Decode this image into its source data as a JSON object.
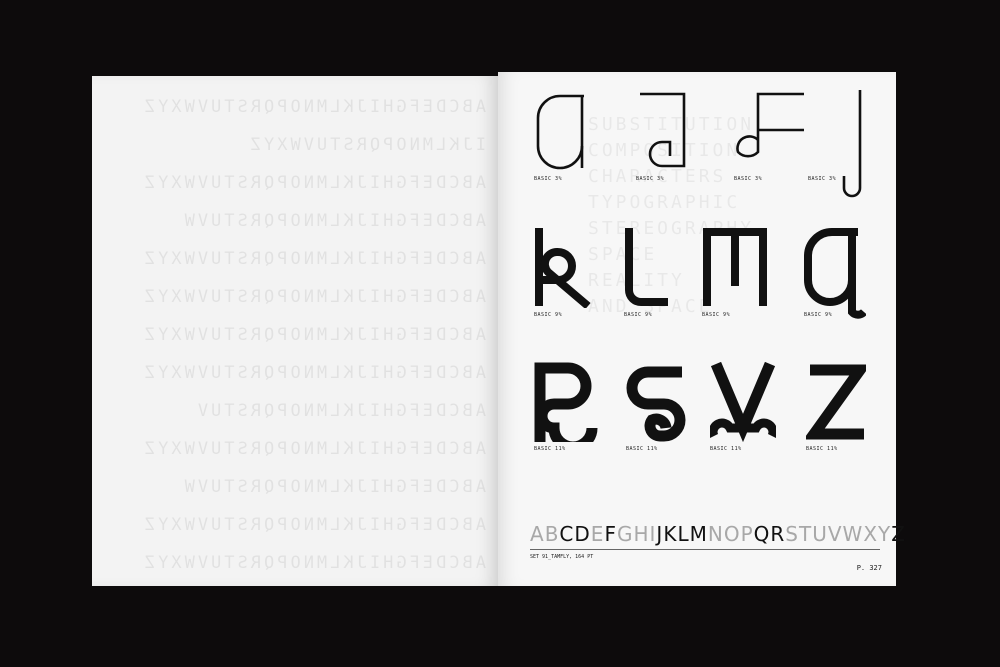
{
  "left_page": {
    "ghost_lines": [
      "ABCDEFGHIJKLMNOPQRSTUVWXYZ",
      "IJKLMNOPQRSTUVWXYZ",
      "ABCDEFGHIJKLMNOPQRSTUVWXYZ",
      "ABCDEFGHIJKLMNOPQRSTUVW",
      "ABCDEFGHIJKLMNOPQRSTUVWXYZ",
      "ABCDEFGHIJKLMNOPQRSTUVWXYZ",
      "ABCDEFGHIJKLMNOPQRSTUVWXYZ",
      "ABCDEFGHIJKLMNOPQRSTUVWXYZ",
      "ABCDEFGHIJKLMNOPQRSTUV",
      "ABCDEFGHIJKLMNOPQRSTUVWXYZ",
      "ABCDEFGHIJKLMNOPQRSTUVW",
      "ABCDEFGHIJKLMNOPQRSTUVWXYZ",
      "ABCDEFGHIJKLMNOPQRSTUVWXYZ"
    ]
  },
  "right_page": {
    "ghost_lines": [
      "SUBSTITUTION",
      "COMPOSITION",
      "CHARACTERS",
      "TYPOGRAPHIC",
      "STEREOGRAPHY",
      "SPACE",
      "REALITY",
      "AND SPACE"
    ],
    "glyph_captions": [
      "BASIC 3%",
      "BASIC 3%",
      "BASIC 3%",
      "BASIC 3%",
      "BASIC 9%",
      "BASIC 9%",
      "BASIC 9%",
      "BASIC 9%",
      "BASIC 11%",
      "BASIC 11%",
      "BASIC 11%",
      "BASIC 11%"
    ],
    "alphabet": [
      "A",
      "B",
      "C",
      "D",
      "E",
      "F",
      "G",
      "H",
      "I",
      "J",
      "K",
      "L",
      "M",
      "N",
      "O",
      "P",
      "Q",
      "R",
      "S",
      "T",
      "U",
      "V",
      "W",
      "X",
      "Y",
      "Z"
    ],
    "alphabet_highlight_color": "#111111",
    "alphabet_muted_color": "#a8a8a8",
    "set_caption": "SET 91_TAMFLY, 164 PT",
    "page_number": "P. 327"
  }
}
